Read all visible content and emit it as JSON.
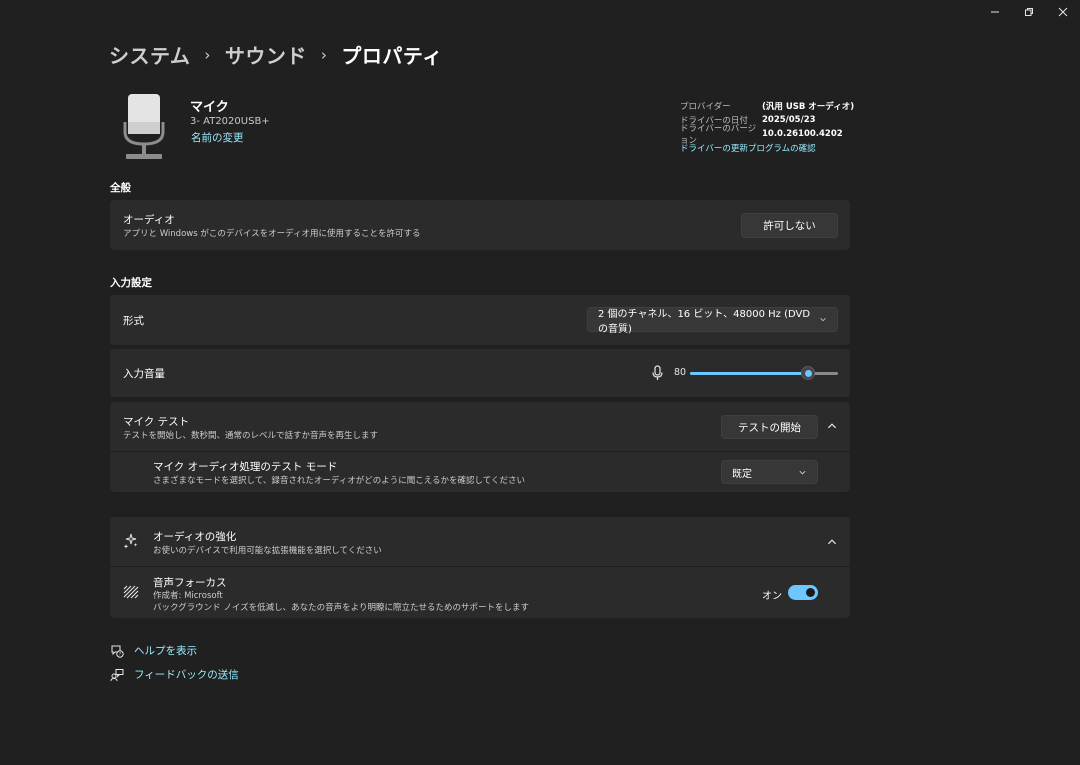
{
  "breadcrumb": [
    "システム",
    "サウンド",
    "プロパティ"
  ],
  "device": {
    "name": "マイク",
    "model": "3- AT2020USB+",
    "rename_link": "名前の変更"
  },
  "driver": {
    "provider_label": "プロバイダー",
    "provider_value": "(汎用 USB オーディオ)",
    "date_label": "ドライバーの日付",
    "date_value": "2025/05/23",
    "version_label": "ドライバーのバージョン",
    "version_value": "10.0.26100.4202",
    "update_link": "ドライバーの更新プログラムの確認"
  },
  "general": {
    "section_title": "全般",
    "audio_title": "オーディオ",
    "audio_desc": "アプリと Windows がこのデバイスをオーディオ用に使用することを許可する",
    "audio_button": "許可しない"
  },
  "input": {
    "section_title": "入力設定",
    "format_title": "形式",
    "format_value": "2 個のチャネル、16 ビット、48000 Hz (DVD の音質)",
    "volume_title": "入力音量",
    "volume_value": "80",
    "volume_level": 80,
    "mic_test_title": "マイク テスト",
    "mic_test_desc": "テストを開始し、数秒間、通常のレベルで話すか音声を再生します",
    "mic_test_button": "テストの開始",
    "mode_title": "マイク オーディオ処理のテスト モード",
    "mode_desc": "さまざまなモードを選択して、録音されたオーディオがどのように聞こえるかを確認してください",
    "mode_value": "既定"
  },
  "enhance": {
    "title": "オーディオの強化",
    "desc": "お使いのデバイスで利用可能な拡張機能を選択してください",
    "focus_title": "音声フォーカス",
    "focus_author": "作成者: Microsoft",
    "focus_desc": "バックグラウンド ノイズを低減し、あなたの音声をより明瞭に際立たせるためのサポートをします",
    "focus_state": "オン"
  },
  "footer": {
    "help": "ヘルプを表示",
    "feedback": "フィードバックの送信"
  },
  "colors": {
    "accent": "#6cc6ff",
    "link": "#99ebff",
    "card": "#2b2b2b",
    "background": "#202020"
  }
}
